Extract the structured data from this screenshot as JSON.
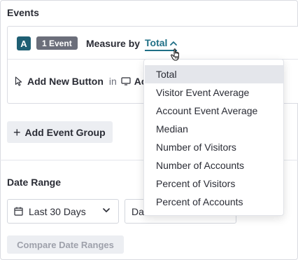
{
  "events": {
    "title": "Events",
    "badge_letter": "A",
    "event_count": "1 Event",
    "measure_label": "Measure by",
    "measure_value": "Total",
    "event_name": "Add New Button",
    "in_label": "in",
    "app_name_partial": "Ac"
  },
  "add_event_group_label": "Add Event Group",
  "date_range": {
    "title": "Date Range",
    "selected_range": "Last 30 Days",
    "second_select_partial": "Da",
    "compare_label": "Compare Date Ranges"
  },
  "measure_dropdown": {
    "selected": "Total",
    "options": [
      "Total",
      "Visitor Event Average",
      "Account Event Average",
      "Median",
      "Number of Visitors",
      "Number of Accounts",
      "Percent of Visitors",
      "Percent of Accounts"
    ]
  },
  "colors": {
    "accent": "#1f6f86",
    "badge_letter_bg": "#1f5f73",
    "badge_count_bg": "#6b6e7a",
    "selected_option_bg": "#e4e6eb"
  },
  "icons": [
    "pointer-cursor-icon",
    "monitor-icon",
    "chevron-up-icon",
    "hand-cursor-icon",
    "calendar-icon",
    "chevron-down-icon",
    "plus-icon"
  ]
}
